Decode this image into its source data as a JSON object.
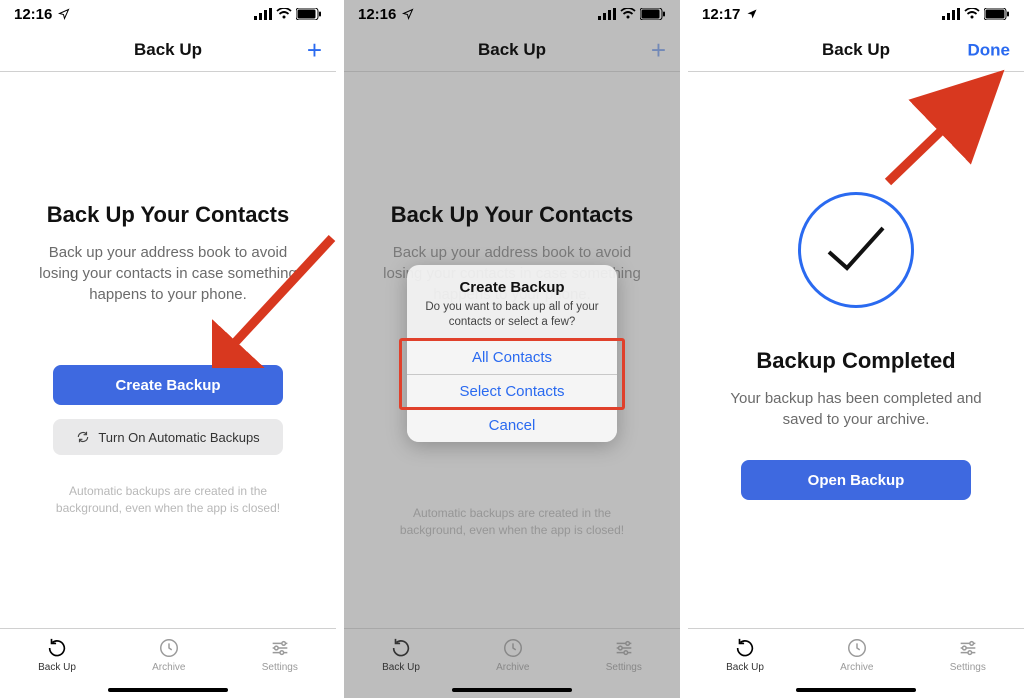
{
  "screens": [
    {
      "status_time": "12:16",
      "nav_title": "Back Up",
      "nav_action": "+",
      "heading": "Back Up Your Contacts",
      "subtitle": "Back up your address book to avoid losing your contacts in case something happens to your phone.",
      "primary_button": "Create Backup",
      "secondary_button": "Turn On Automatic Backups",
      "hint": "Automatic backups are created in the background, even when the app is closed!",
      "tabs": {
        "backup": "Back Up",
        "archive": "Archive",
        "settings": "Settings"
      }
    },
    {
      "status_time": "12:16",
      "nav_title": "Back Up",
      "nav_action": "+",
      "heading": "Back Up Your Contacts",
      "subtitle": "Back up your address book to avoid losing your contacts in case something happens to your phone.",
      "hint": "Automatic backups are created in the background, even when the app is closed!",
      "alert": {
        "title": "Create Backup",
        "message": "Do you want to back up all of your contacts or select a few?",
        "option1": "All Contacts",
        "option2": "Select Contacts",
        "cancel": "Cancel"
      },
      "tabs": {
        "backup": "Back Up",
        "archive": "Archive",
        "settings": "Settings"
      }
    },
    {
      "status_time": "12:17",
      "nav_title": "Back Up",
      "nav_action": "Done",
      "heading": "Backup Completed",
      "subtitle": "Your backup has been completed and saved to your archive.",
      "primary_button": "Open Backup",
      "tabs": {
        "backup": "Back Up",
        "archive": "Archive",
        "settings": "Settings"
      }
    }
  ]
}
